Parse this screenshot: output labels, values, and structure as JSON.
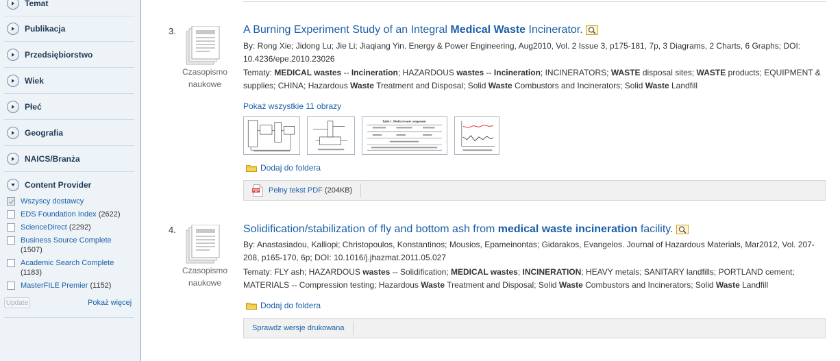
{
  "sidebar": {
    "facets": [
      {
        "label": "Temat",
        "open": false
      },
      {
        "label": "Publikacja",
        "open": false
      },
      {
        "label": "Przedsiębiorstwo",
        "open": false
      },
      {
        "label": "Wiek",
        "open": false
      },
      {
        "label": "Płeć",
        "open": false
      },
      {
        "label": "Geografia",
        "open": false
      },
      {
        "label": "NAICS/Branża",
        "open": false
      },
      {
        "label": "Content Provider",
        "open": true
      }
    ],
    "providers": [
      {
        "label": "Wszyscy dostawcy",
        "count": "",
        "checked": true
      },
      {
        "label": "EDS Foundation Index",
        "count": "(2622)",
        "checked": false
      },
      {
        "label": "ScienceDirect",
        "count": "(2292)",
        "checked": false
      },
      {
        "label": "Business Source Complete",
        "count": "(1507)",
        "checked": false
      },
      {
        "label": "Academic Search Complete",
        "count": "(1183)",
        "checked": false
      },
      {
        "label": "MasterFILE Premier",
        "count": "(1152)",
        "checked": false
      }
    ],
    "update_label": "Update",
    "more_label": "Pokaż więcej"
  },
  "results": [
    {
      "number": "3.",
      "doctype_line1": "Czasopismo",
      "doctype_line2": "naukowe",
      "title_a": "A Burning Experiment Study of an Integral ",
      "title_b": "Medical Waste",
      "title_c": " Incinerator.",
      "byline": "By: Rong Xie; Jidong Lu; Jie Li; Jiaqiang Yin. Energy & Power Engineering, Aug2010, Vol. 2 Issue 3, p175-181, 7p, 3 Diagrams, 2 Charts, 6 Graphs; DOI: 10.4236/epe.2010.23026",
      "subjects_html": "Tematy: <b>MEDICAL wastes</b> -- <b>Incineration</b>; HAZARDOUS <b>wastes</b> -- <b>Incineration</b>; INCINERATORS; <b>WASTE</b> disposal sites; <b>WASTE</b> products; EQUIPMENT & supplies; CHINA; Hazardous <b>Waste</b> Treatment and Disposal; Solid <b>Waste</b> Combustors and Incinerators; Solid <b>Waste</b> Landfill",
      "show_images": "Pokaż wszystkie 11 obrazy",
      "folder": "Dodaj do foldera",
      "fulltext_label": "Pełny tekst PDF",
      "fulltext_size": "(204KB)",
      "thumb_table_title": "Table 1. Medical waste component"
    },
    {
      "number": "4.",
      "doctype_line1": "Czasopismo",
      "doctype_line2": "naukowe",
      "title_a": "Solidification/stabilization of fly and bottom ash from ",
      "title_b": "medical waste incineration",
      "title_c": " facility.",
      "byline": "By: Anastasiadou, Kalliopi; Christopoulos, Konstantinos; Mousios, Epameinontas; Gidarakos, Evangelos. Journal of Hazardous Materials, Mar2012, Vol. 207-208, p165-170, 6p; DOI: 10.1016/j.jhazmat.2011.05.027",
      "subjects_html": "Tematy: FLY ash; HAZARDOUS <b>wastes</b> -- Solidification; <b>MEDICAL wastes</b>; <b>INCINERATION</b>; HEAVY metals; SANITARY landfills; PORTLAND cement; MATERIALS -- Compression testing; Hazardous <b>Waste</b> Treatment and Disposal; Solid <b>Waste</b> Combustors and Incinerators; Solid <b>Waste</b> Landfill",
      "folder": "Dodaj do foldera",
      "print_label": "Sprawdz wersje drukowana"
    }
  ]
}
